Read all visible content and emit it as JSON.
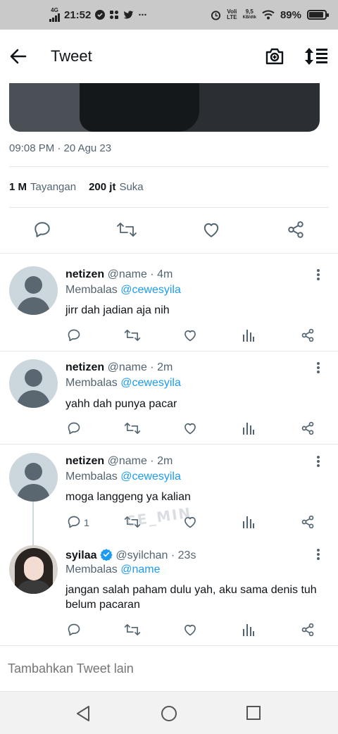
{
  "status_bar": {
    "network": "4G",
    "time": "21:52",
    "carrier": "Voli",
    "lte": "LTE",
    "speed": "9,5",
    "speed_unit": "KB/dtk",
    "battery": "89%",
    "battery_level": 0.89,
    "more": "···"
  },
  "header": {
    "title": "Tweet"
  },
  "tweet": {
    "timestamp": "09:08 PM · 20 Agu 23",
    "views_count": "1 M",
    "views_label": "Tayangan",
    "likes_count": "200 jt",
    "likes_label": "Suka"
  },
  "replies": [
    {
      "name": "netizen",
      "handle": "@name · 4m",
      "replying_prefix": "Membalas",
      "replying_to": "@cewesyila",
      "text": "jirr dah jadian aja nih",
      "reply_count": ""
    },
    {
      "name": "netizen",
      "handle": "@name · 2m",
      "replying_prefix": "Membalas",
      "replying_to": "@cewesyila",
      "text": "yahh dah punya pacar",
      "reply_count": ""
    },
    {
      "name": "netizen",
      "handle": "@name · 2m",
      "replying_prefix": "Membalas",
      "replying_to": "@cewesyila",
      "text": "moga langgeng ya kalian",
      "reply_count": "1"
    },
    {
      "name": "syilaa",
      "handle": "@syilchan · 23s",
      "replying_prefix": "Membalas",
      "replying_to": "@name",
      "text": "jangan salah paham dulu yah, aku sama denis tuh belum pacaran",
      "reply_count": ""
    }
  ],
  "watermark": "CE_MIN",
  "compose": {
    "placeholder": "Tambahkan Tweet lain"
  },
  "colors": {
    "accent": "#1d9bf0",
    "muted": "#536471",
    "text": "#0f1419"
  }
}
